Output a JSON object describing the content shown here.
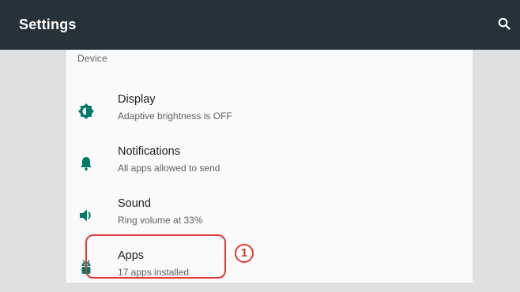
{
  "app_bar": {
    "title": "Settings",
    "search_icon": "search-icon"
  },
  "section": {
    "header": "Device"
  },
  "items": [
    {
      "icon": "brightness-icon",
      "title": "Display",
      "summary": "Adaptive brightness is OFF"
    },
    {
      "icon": "bell-icon",
      "title": "Notifications",
      "summary": "All apps allowed to send"
    },
    {
      "icon": "volume-icon",
      "title": "Sound",
      "summary": "Ring volume at 33%"
    },
    {
      "icon": "android-icon",
      "title": "Apps",
      "summary": "17 apps installed"
    }
  ],
  "annotation": {
    "marker_label": "1",
    "color": "#e53935"
  },
  "colors": {
    "app_bar": "#263238",
    "accent": "#00796b",
    "background": "#e0e0e0",
    "panel": "#fafafa"
  }
}
